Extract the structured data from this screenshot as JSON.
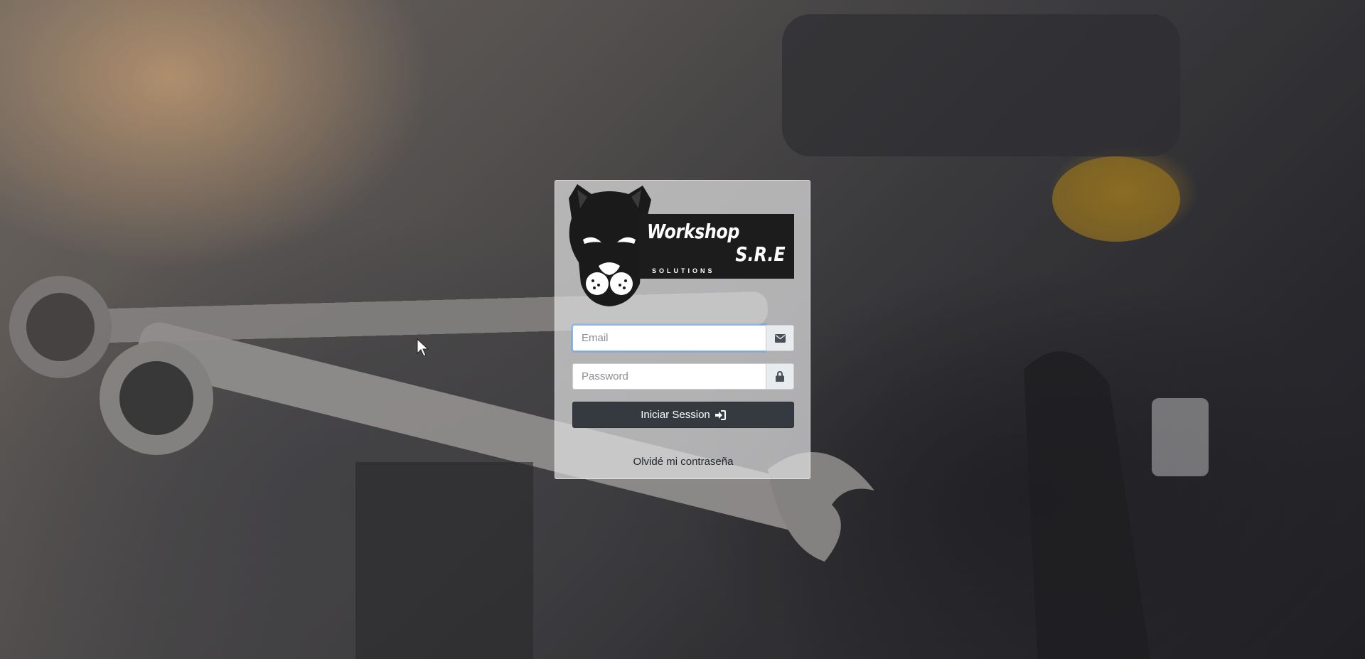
{
  "brand": {
    "name_line1": "Workshop",
    "name_line2": "S.R.E",
    "tagline": "SOLUTIONS"
  },
  "login": {
    "email_placeholder": "Email",
    "email_value": "",
    "password_placeholder": "Password",
    "password_value": "",
    "submit_label": "Iniciar Session",
    "forgot_label": "Olvidé mi contraseña"
  },
  "icons": {
    "email_addon": "envelope-icon",
    "password_addon": "lock-icon",
    "submit": "sign-in-icon"
  },
  "colors": {
    "button_bg": "#343a40",
    "focus_border": "#80bdff",
    "addon_bg": "#e9ecef"
  }
}
